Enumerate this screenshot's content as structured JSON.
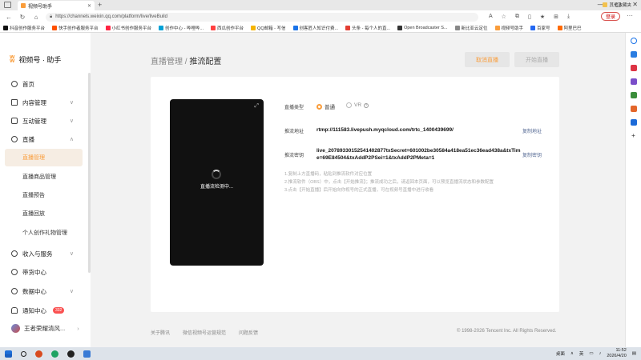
{
  "browser": {
    "tab_title": "视频号助手",
    "url_prefix": "https://",
    "url": "channels.weixin.qq.com/platform/live/liveBuild",
    "login_label": "登录",
    "favorites": [
      {
        "label": "抖音创作服务平台",
        "color": "#111111"
      },
      {
        "label": "快手创作者服务平台",
        "color": "#ff5000"
      },
      {
        "label": "小红书创作服务平台",
        "color": "#ff2442"
      },
      {
        "label": "创作中心 - 哔哩哔...",
        "color": "#00a1d6"
      },
      {
        "label": "西瓜创作平台",
        "color": "#ff4040"
      },
      {
        "label": "QQ邮箱 - 写信",
        "color": "#f5b400"
      },
      {
        "label": "创客匠人知识付费...",
        "color": "#1a73e8"
      },
      {
        "label": "头条 - 每个人的直...",
        "color": "#e33e33"
      },
      {
        "label": "Open Broadcaster S...",
        "color": "#333333"
      },
      {
        "label": "新比亚云定位",
        "color": "#888888"
      },
      {
        "label": "视频号助手",
        "color": "#fa9d3b"
      },
      {
        "label": "百家号",
        "color": "#2468f2"
      },
      {
        "label": "阿里巴巴",
        "color": "#ff6a00"
      }
    ],
    "other_favorites": "其他收藏夹"
  },
  "sidebar": {
    "logo_text": "视频号 · 助手",
    "items": [
      {
        "label": "首页",
        "icon": "home-icon"
      },
      {
        "label": "内容管理",
        "icon": "content-icon",
        "chevron": "∨"
      },
      {
        "label": "互动管理",
        "icon": "interaction-icon",
        "chevron": "∨"
      },
      {
        "label": "直播",
        "icon": "live-icon",
        "chevron": "∧"
      }
    ],
    "live_sub": [
      {
        "label": "直播管理",
        "active": true
      },
      {
        "label": "直播商品管理",
        "active": false
      },
      {
        "label": "直播预告",
        "active": false
      },
      {
        "label": "直播回放",
        "active": false
      },
      {
        "label": "个人创作礼物管理",
        "active": false
      }
    ],
    "items_after": [
      {
        "label": "收入与服务",
        "icon": "income-icon",
        "chevron": "∨"
      },
      {
        "label": "带货中心",
        "icon": "commerce-icon",
        "chevron": ""
      },
      {
        "label": "数据中心",
        "icon": "data-icon",
        "chevron": "∨"
      },
      {
        "label": "通知中心",
        "icon": "bell-icon",
        "chevron": "",
        "badge": "332"
      }
    ],
    "user_name": "王者荣耀清风...",
    "user_chevron": "›"
  },
  "header": {
    "breadcrumb_parent": "直播管理",
    "separator": " / ",
    "breadcrumb_current": "推流配置",
    "cancel_label": "取消直播",
    "start_label": "开始直播"
  },
  "config": {
    "preview_status": "直播流检测中...",
    "type_label": "直播类型",
    "type_normal": "普通",
    "type_vr": "VR",
    "address_label": "推流地址",
    "address_value": "rtmp://111583.livepush.myqcloud.com/trtc_1400439699/",
    "copy_address": "复制地址",
    "key_label": "推流密钥",
    "key_value_line1": "live_20789330152541402877txSecret=601002be30584a418ea51ec36ead438a&txTim",
    "key_value_line2": "e=69E84504&txAddP2PSei=1&txAddP2PMeta=1",
    "copy_key": "复制密钥",
    "notes": [
      "1.复制上方直播码，粘贴到推流软件对应位置",
      "2.推流软件（OBS）中，点击【开始推流】；推流成功之后，请返回本页面，可以预览直播流状态和参数配置",
      "3.点击【开始直播】后开始向你视号的正式直播，可在视频号直播中进行收看"
    ]
  },
  "footer": {
    "about": "关于腾讯",
    "rules": "微信视频号运营规范",
    "feedback": "问题反馈",
    "copyright": "© 1998-2026 Tencent Inc. All Rights Reserved."
  },
  "taskbar": {
    "desktop_label": "桌面",
    "ime": "英",
    "time": "11:52",
    "date": "2026/4/20"
  }
}
